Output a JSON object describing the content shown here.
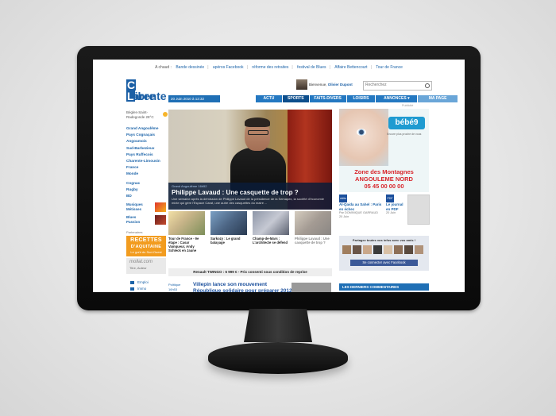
{
  "top_links": {
    "prefix": "A chaud :",
    "items": [
      "Bande dessinée",
      "apéros Facebook",
      "réforme des retraites",
      "festival de Blues",
      "Affaire Bettencourt",
      "Tour de France"
    ]
  },
  "logo": {
    "line1_cap": "C",
    "line1": "harente",
    "line2_cap": "L",
    "line2": "ibre"
  },
  "user": {
    "greeting": "Bienvenue,",
    "name": "Olivier Dupont"
  },
  "search": {
    "placeholder": "Recherchez"
  },
  "date": "20 Juin 2010 à 12:32",
  "nav": [
    "ACTU",
    "SPORTS",
    "FAITS-DIVERS",
    "LOISIRS",
    "ANNONCES ▾",
    "MA PAGE"
  ],
  "weather": {
    "line1": "Bègles-Saint-",
    "line2": "Radegonde 28°C"
  },
  "sidebar": {
    "regions": [
      "Grand Angoulême",
      "Pays Cognaçais",
      "Angoumois",
      "Sud-Barbezieux",
      "Pays Ruffecois",
      "Charente-Limousin",
      "France",
      "Monde"
    ],
    "sports": [
      "Cognac",
      "Rugby",
      "BD"
    ],
    "features": [
      {
        "label": "Musiques Métisses"
      },
      {
        "label": "Blues Passion"
      }
    ],
    "partner_label": "Partenaires",
    "recettes_title": "RECETTES",
    "recettes_sub": "D'AQUITAINE",
    "recettes_tag": "Le goût du Sud-Ouest",
    "mollat_title": "mollat.com",
    "mollat_sub": "Titre, Auteur",
    "links": [
      "Emploi",
      "Immo"
    ]
  },
  "hero": {
    "category": "Grand Angoulême 16h52",
    "title": "Philippe Lavaud : Une casquette de trop ?",
    "summary": "Une semaine après la démission de Philippe Lavaud de la présidence de la Semapex, la société d'économie mixte qui gère l'Espace Carat, une autre des casquettes du maire ..."
  },
  "thumbs": [
    {
      "caption": "Tour de France - 9e étape : Casar Vainqueur, Andy Schleck en Jaune"
    },
    {
      "caption": "Sarkozy : Le grand balayage"
    },
    {
      "caption": "Champ-de-Mars : L'architecte se défend"
    },
    {
      "caption": "Philippe Lavaud : Une casquette de trop ?"
    }
  ],
  "promo": "Renault TWINGO : 6 999 € - Prix consenti sous condition de reprise",
  "article": {
    "category": "Politique",
    "time": "16h53",
    "title": "Villepin lance son mouvement République solidaire pour préparer 2012"
  },
  "right": {
    "rubrique": "Publicité",
    "ad_brand": "bébé9",
    "ad_sub": "Encore plus proche de vous",
    "ad_zone1": "Zone des Montagnes",
    "ad_zone2": "ANGOULEME NORD",
    "ad_phone": "05 45 00 00 00",
    "news1_icon": "édito",
    "news1_title": "Al-Qaida au Sahel : Paris en échec",
    "news1_meta1": "Par DOMINIQUE GARRAUD",
    "news1_meta2": "20 Juin",
    "news2_icon": "PDF",
    "news2_title": "Le journal en PDF",
    "news2_meta": "20 Juin",
    "fb_prompt": "Partagez toutes vos infos avec vos amis !",
    "fb_button": "Se connecter avec Facebook",
    "comments_header": "LES DERNIERS COMMENTAIRES"
  }
}
